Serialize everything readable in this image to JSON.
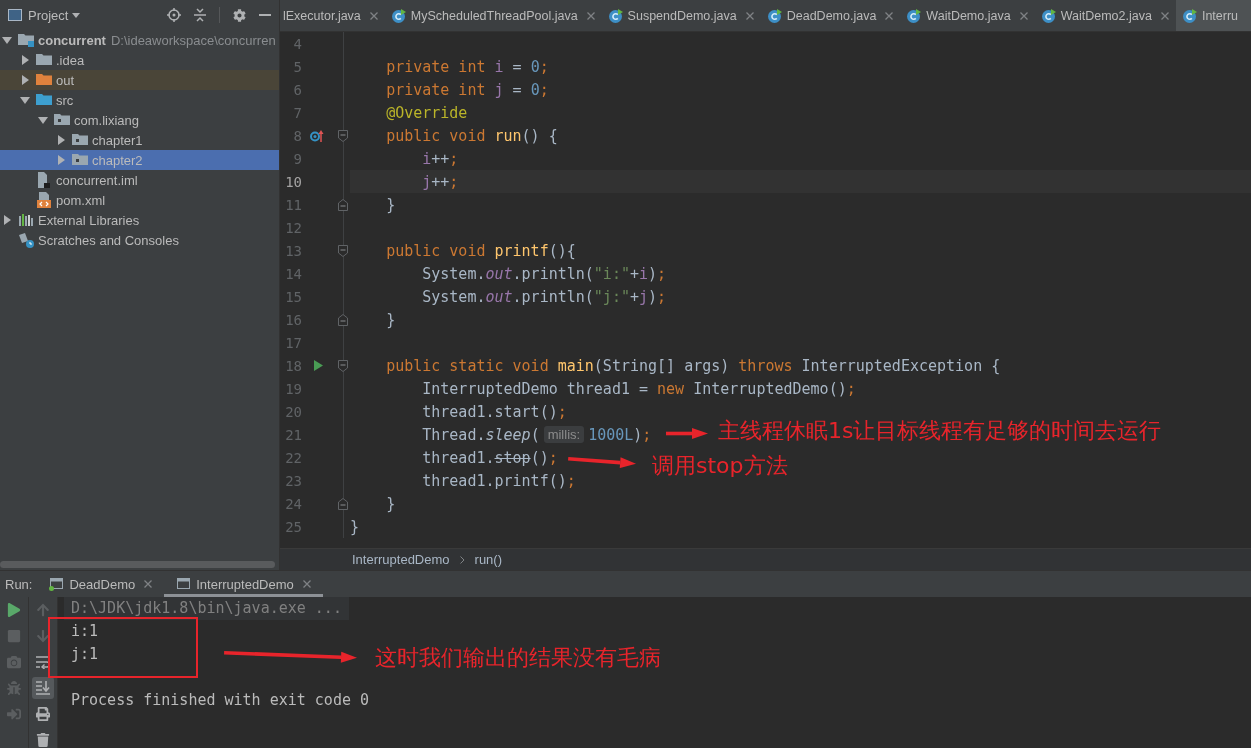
{
  "project_panel": {
    "title": "Project",
    "tree": [
      {
        "label": "concurrent",
        "path": "D:\\ideaworkspace\\concurren",
        "kind": "module",
        "expanded": true,
        "selected": false,
        "children": [
          {
            "label": ".idea",
            "kind": "folder",
            "expanded": false,
            "selected": false
          },
          {
            "label": "out",
            "kind": "excluded-folder",
            "expanded": false,
            "selected": false
          },
          {
            "label": "src",
            "kind": "source-folder",
            "expanded": true,
            "selected": false,
            "children": [
              {
                "label": "com.lixiang",
                "kind": "package",
                "expanded": true,
                "selected": false,
                "children": [
                  {
                    "label": "chapter1",
                    "kind": "package",
                    "expanded": false,
                    "selected": false
                  },
                  {
                    "label": "chapter2",
                    "kind": "package",
                    "expanded": false,
                    "selected": true
                  }
                ]
              }
            ]
          },
          {
            "label": "concurrent.iml",
            "kind": "module-file",
            "selected": false
          },
          {
            "label": "pom.xml",
            "kind": "maven-file",
            "selected": false
          }
        ]
      },
      {
        "label": "External Libraries",
        "kind": "libraries",
        "expanded": false,
        "selected": false
      },
      {
        "label": "Scratches and Consoles",
        "kind": "scratches",
        "selected": false
      }
    ]
  },
  "editor_tabs": [
    {
      "label": "lExecutor.java",
      "icon": false,
      "close": true,
      "selected": false
    },
    {
      "label": "MyScheduledThreadPool.java",
      "icon": true,
      "close": true,
      "selected": false
    },
    {
      "label": "SuspendDemo.java",
      "icon": true,
      "close": true,
      "selected": false
    },
    {
      "label": "DeadDemo.java",
      "icon": true,
      "close": true,
      "selected": false
    },
    {
      "label": "WaitDemo.java",
      "icon": true,
      "close": true,
      "selected": false
    },
    {
      "label": "WaitDemo2.java",
      "icon": true,
      "close": true,
      "selected": false
    },
    {
      "label": "Interru",
      "icon": true,
      "close": false,
      "selected": true
    }
  ],
  "code": {
    "lines": [
      {
        "number": "4",
        "current": false
      },
      {
        "number": "5",
        "current": false,
        "tokens": [
          {
            "kind": "keyword",
            "text": "    private int "
          },
          {
            "kind": "field",
            "text": "i"
          },
          {
            "kind": "plain",
            "text": " = "
          },
          {
            "kind": "number",
            "text": "0"
          },
          {
            "kind": "keyword",
            "text": ";"
          }
        ]
      },
      {
        "number": "6",
        "current": false,
        "tokens": [
          {
            "kind": "keyword",
            "text": "    private int "
          },
          {
            "kind": "field",
            "text": "j"
          },
          {
            "kind": "plain",
            "text": " = "
          },
          {
            "kind": "number",
            "text": "0"
          },
          {
            "kind": "keyword",
            "text": ";"
          }
        ]
      },
      {
        "number": "7",
        "current": false,
        "tokens": [
          {
            "kind": "annotation",
            "text": "    @Override"
          }
        ]
      },
      {
        "number": "8",
        "current": false,
        "marker": {
          "kind": "override"
        },
        "fold": {
          "kind": "start"
        },
        "tokens": [
          {
            "kind": "keyword",
            "text": "    public void "
          },
          {
            "kind": "method",
            "text": "run"
          },
          {
            "kind": "plain",
            "text": "() {"
          }
        ]
      },
      {
        "number": "9",
        "current": false,
        "tokens": [
          {
            "kind": "field",
            "text": "        i"
          },
          {
            "kind": "plain",
            "text": "++"
          },
          {
            "kind": "keyword",
            "text": ";"
          }
        ]
      },
      {
        "number": "10",
        "current": true,
        "tokens": [
          {
            "kind": "field",
            "text": "        j"
          },
          {
            "kind": "plain",
            "text": "++"
          },
          {
            "kind": "keyword",
            "text": ";"
          }
        ]
      },
      {
        "number": "11",
        "current": false,
        "fold": {
          "kind": "end"
        },
        "tokens": [
          {
            "kind": "plain",
            "text": "    }"
          }
        ]
      },
      {
        "number": "12",
        "current": false
      },
      {
        "number": "13",
        "current": false,
        "fold": {
          "kind": "start"
        },
        "tokens": [
          {
            "kind": "keyword",
            "text": "    public void "
          },
          {
            "kind": "method",
            "text": "printf"
          },
          {
            "kind": "plain",
            "text": "(){"
          }
        ]
      },
      {
        "number": "14",
        "current": false,
        "tokens": [
          {
            "kind": "plain",
            "text": "        System."
          },
          {
            "kind": "static-field",
            "text": "out"
          },
          {
            "kind": "plain",
            "text": ".println("
          },
          {
            "kind": "string",
            "text": "\"i:\""
          },
          {
            "kind": "plain",
            "text": "+"
          },
          {
            "kind": "field",
            "text": "i"
          },
          {
            "kind": "plain",
            "text": ")"
          },
          {
            "kind": "keyword",
            "text": ";"
          }
        ]
      },
      {
        "number": "15",
        "current": false,
        "tokens": [
          {
            "kind": "plain",
            "text": "        System."
          },
          {
            "kind": "static-field",
            "text": "out"
          },
          {
            "kind": "plain",
            "text": ".println("
          },
          {
            "kind": "string",
            "text": "\"j:\""
          },
          {
            "kind": "plain",
            "text": "+"
          },
          {
            "kind": "field",
            "text": "j"
          },
          {
            "kind": "plain",
            "text": ")"
          },
          {
            "kind": "keyword",
            "text": ";"
          }
        ]
      },
      {
        "number": "16",
        "current": false,
        "fold": {
          "kind": "end"
        },
        "tokens": [
          {
            "kind": "plain",
            "text": "    }"
          }
        ]
      },
      {
        "number": "17",
        "current": false
      },
      {
        "number": "18",
        "current": false,
        "marker": {
          "kind": "run"
        },
        "fold": {
          "kind": "start"
        },
        "tokens": [
          {
            "kind": "keyword",
            "text": "    public static void "
          },
          {
            "kind": "method",
            "text": "main"
          },
          {
            "kind": "plain",
            "text": "(String[] args) "
          },
          {
            "kind": "keyword",
            "text": "throws "
          },
          {
            "kind": "plain",
            "text": "InterruptedException {"
          }
        ]
      },
      {
        "number": "19",
        "current": false,
        "tokens": [
          {
            "kind": "plain",
            "text": "        InterruptedDemo thread1 = "
          },
          {
            "kind": "keyword",
            "text": "new "
          },
          {
            "kind": "plain",
            "text": "InterruptedDemo()"
          },
          {
            "kind": "keyword",
            "text": ";"
          }
        ]
      },
      {
        "number": "20",
        "current": false,
        "tokens": [
          {
            "kind": "plain",
            "text": "        thread1.start()"
          },
          {
            "kind": "keyword",
            "text": ";"
          }
        ]
      },
      {
        "number": "21",
        "current": false,
        "tokens": [
          {
            "kind": "plain",
            "text": "        Thread."
          },
          {
            "kind": "static-method",
            "text": "sleep"
          },
          {
            "kind": "plain",
            "text": "("
          },
          {
            "kind": "hint",
            "text": "millis:"
          },
          {
            "kind": "number",
            "text": "1000L"
          },
          {
            "kind": "plain",
            "text": ")"
          },
          {
            "kind": "keyword",
            "text": ";"
          }
        ]
      },
      {
        "number": "22",
        "current": false,
        "tokens": [
          {
            "kind": "plain",
            "text": "        thread1."
          },
          {
            "kind": "deprecated",
            "text": "stop"
          },
          {
            "kind": "plain",
            "text": "()"
          },
          {
            "kind": "keyword",
            "text": ";"
          }
        ]
      },
      {
        "number": "23",
        "current": false,
        "tokens": [
          {
            "kind": "plain",
            "text": "        thread1.printf()"
          },
          {
            "kind": "keyword",
            "text": ";"
          }
        ]
      },
      {
        "number": "24",
        "current": false,
        "fold": {
          "kind": "end"
        },
        "tokens": [
          {
            "kind": "plain",
            "text": "    }"
          }
        ]
      },
      {
        "number": "25",
        "current": false,
        "tokens": [
          {
            "kind": "plain",
            "text": "}"
          }
        ]
      }
    ]
  },
  "breadcrumbs": [
    "InterruptedDemo",
    "run()"
  ],
  "annotations": [
    {
      "text": "主线程休眠1s让目标线程有足够的时间去运行"
    },
    {
      "text": "调用stop方法"
    },
    {
      "text": "这时我们输出的结果没有毛病"
    }
  ],
  "run_panel": {
    "title": "Run:",
    "tabs": [
      {
        "label": "DeadDemo",
        "running": true,
        "selected": false
      },
      {
        "label": "InterruptedDemo",
        "running": false,
        "selected": true
      }
    ],
    "toolbar_left": [
      {
        "kind": "play",
        "disabled": false
      },
      {
        "kind": "stop",
        "disabled": true
      },
      {
        "kind": "camera",
        "disabled": true
      },
      {
        "kind": "bug",
        "disabled": true
      },
      {
        "kind": "exit",
        "disabled": true
      }
    ],
    "toolbar_right": [
      {
        "kind": "up",
        "disabled": true,
        "on": false
      },
      {
        "kind": "down",
        "disabled": true,
        "on": false
      },
      {
        "kind": "wrap",
        "disabled": false,
        "on": false
      },
      {
        "kind": "scroll-end",
        "disabled": false,
        "on": true
      },
      {
        "kind": "print",
        "disabled": false,
        "on": false
      },
      {
        "kind": "trash",
        "disabled": false,
        "on": false
      }
    ],
    "console": [
      {
        "kind": "command",
        "text": "D:\\JDK\\jdk1.8\\bin\\java.exe ..."
      },
      {
        "kind": "output",
        "text": "i:1"
      },
      {
        "kind": "output",
        "text": "j:1"
      },
      {
        "kind": "exit",
        "text": "Process finished with exit code 0"
      }
    ]
  }
}
